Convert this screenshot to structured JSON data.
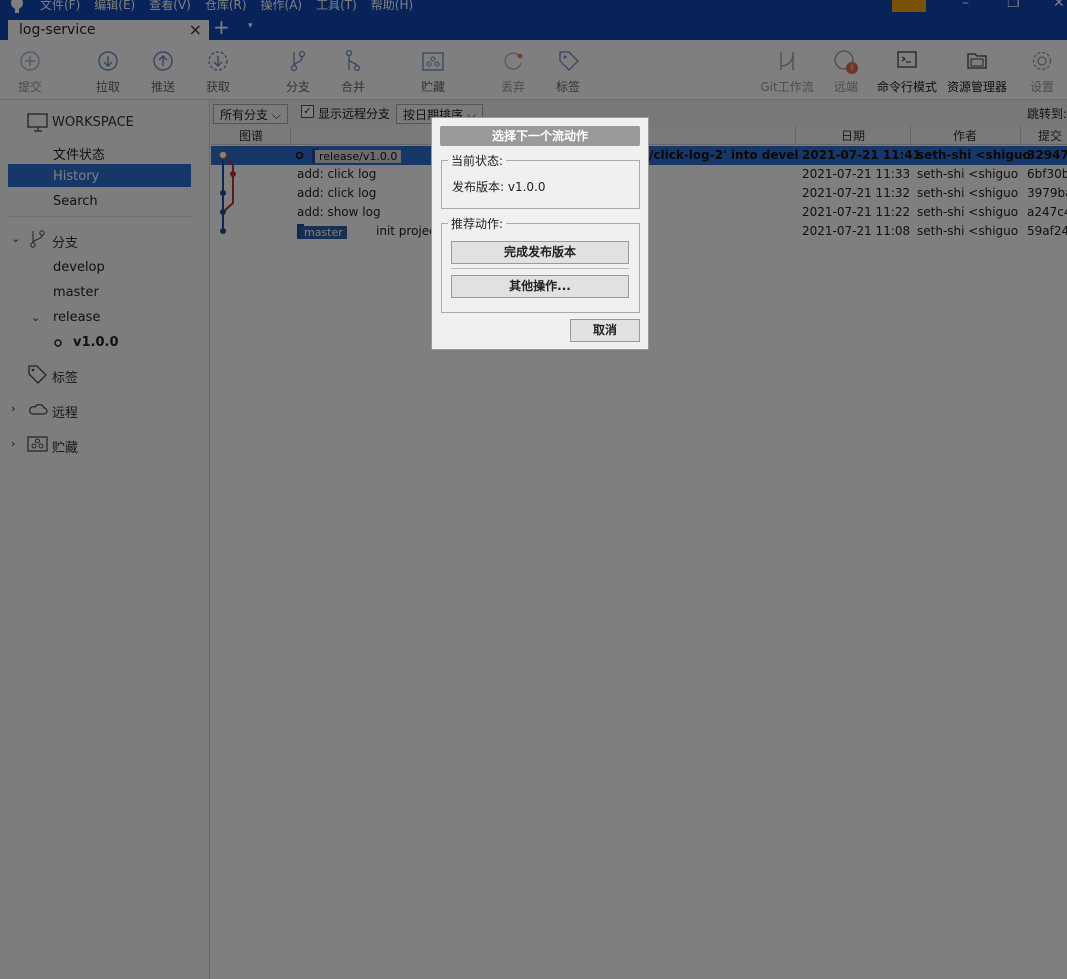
{
  "menu": [
    "文件(F)",
    "编辑(E)",
    "查看(V)",
    "仓库(R)",
    "操作(A)",
    "工具(T)",
    "帮助(H)"
  ],
  "tab": {
    "title": "log-service",
    "close": "×",
    "add": "+",
    "dropdown": "▾"
  },
  "toolbar": {
    "commit": "提交",
    "pull": "拉取",
    "push": "推送",
    "fetch": "获取",
    "branch": "分支",
    "merge": "合并",
    "stash": "贮藏",
    "discard": "丢弃",
    "tag": "标签",
    "gitflow": "Git工作流",
    "remote": "远端",
    "terminal": "命令行模式",
    "explorer": "资源管理器",
    "settings": "设置"
  },
  "sidebar": {
    "workspace": "WORKSPACE",
    "file_status": "文件状态",
    "history": "History",
    "search": "Search",
    "branches": "分支",
    "develop": "develop",
    "master": "master",
    "release": "release",
    "v100": "v1.0.0",
    "tags": "标签",
    "remotes": "远程",
    "stashes": "贮藏"
  },
  "filters": {
    "all_branches": "所有分支 ⌵",
    "show_remote": "显示远程分支",
    "sort": "按日期排序 ⌵",
    "jump": "跳转到:"
  },
  "columns": {
    "graph": "图谱",
    "date": "日期",
    "author": "作者",
    "commit": "提交"
  },
  "commits": [
    {
      "tag": "release/v1.0.0",
      "desc": "/click-log-2' into devel",
      "date": "2021-07-21 11:41",
      "author": "seth-shi <shiguo",
      "hash": "329478"
    },
    {
      "desc": "add: click log",
      "date": "2021-07-21 11:33",
      "author": "seth-shi <shiguo",
      "hash": "6bf30b"
    },
    {
      "desc": "add: click log",
      "date": "2021-07-21 11:32",
      "author": "seth-shi <shiguo",
      "hash": "3979ba"
    },
    {
      "desc": "add: show log",
      "date": "2021-07-21 11:22",
      "author": "seth-shi <shiguo",
      "hash": "a247c4"
    },
    {
      "tag": "master",
      "desc": "init projec",
      "date": "2021-07-21 11:08",
      "author": "seth-shi <shiguo",
      "hash": "59af24"
    }
  ],
  "dialog": {
    "title": "选择下一个流动作",
    "current_state_label": "当前状态:",
    "current_state_value": "发布版本: v1.0.0",
    "recommended_label": "推荐动作:",
    "finish_release": "完成发布版本",
    "other_actions": "其他操作...",
    "cancel": "取消"
  },
  "colors": {
    "titlebar": "#0f47b3",
    "selection": "#2f6fd0",
    "accent_orange": "#f5a30a",
    "graph_red": "#c0303a",
    "graph_blue": "#1e4f9c"
  }
}
